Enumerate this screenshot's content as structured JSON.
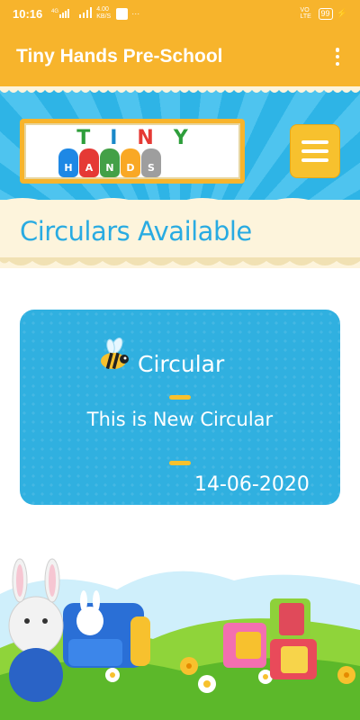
{
  "status_bar": {
    "time": "10:16",
    "network_left": "4G",
    "speed": "4.00 KB/S",
    "network_right": "VO LTE",
    "battery": "99"
  },
  "app_bar": {
    "title": "Tiny Hands Pre-School"
  },
  "logo": {
    "word_top": "TINY",
    "word_top_letters": [
      "T",
      "I",
      "N",
      "Y"
    ],
    "word_top_colors": [
      "#2e9e3b",
      "#1a88c9",
      "#e53935",
      "#2e9e3b"
    ],
    "hands_letters": [
      "H",
      "A",
      "N",
      "D",
      "S"
    ],
    "hand_colors": [
      "#1e88e5",
      "#e53935",
      "#43a047",
      "#f9a825",
      "#9e9e9e"
    ]
  },
  "page": {
    "title": "Circulars Available"
  },
  "circular": {
    "heading": "Circular",
    "description": "This is New Circular",
    "date": "14-06-2020"
  },
  "colors": {
    "accent": "#f7b42c",
    "primary_blue": "#29abe2",
    "card_blue": "#30b0e0"
  }
}
